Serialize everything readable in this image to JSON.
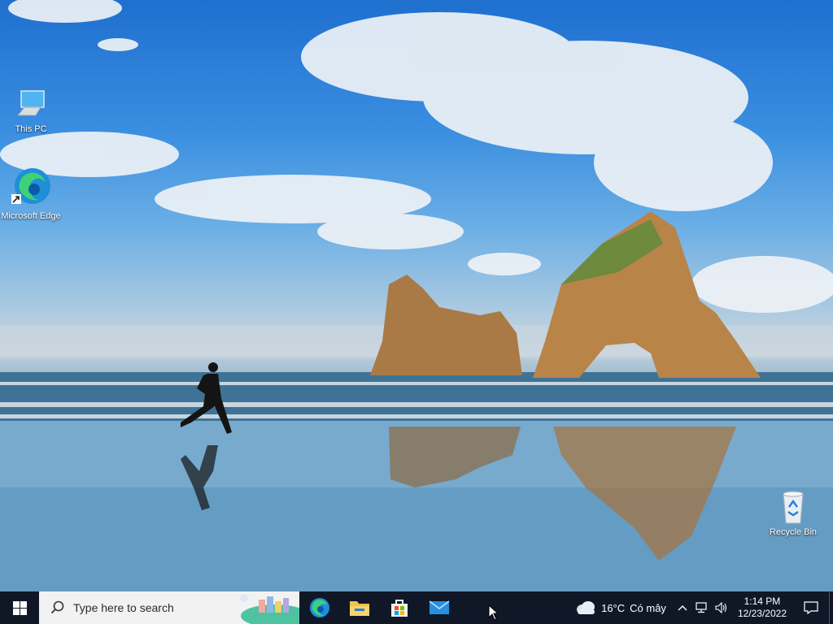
{
  "desktop": {
    "icons": [
      {
        "label": "This PC"
      },
      {
        "label": "Microsoft Edge"
      },
      {
        "label": "Recycle Bin"
      }
    ]
  },
  "taskbar": {
    "search_placeholder": "Type here to search",
    "apps": [
      "edge-icon",
      "file-explorer-icon",
      "store-icon",
      "mail-icon"
    ],
    "weather": {
      "temp": "16°C",
      "condition": "Có mây"
    },
    "clock": {
      "time": "1:14 PM",
      "date": "12/23/2022"
    }
  },
  "colors": {
    "taskbar_bg": "#101828",
    "search_bg": "#f2f2f2",
    "accent": "#0078d4"
  }
}
